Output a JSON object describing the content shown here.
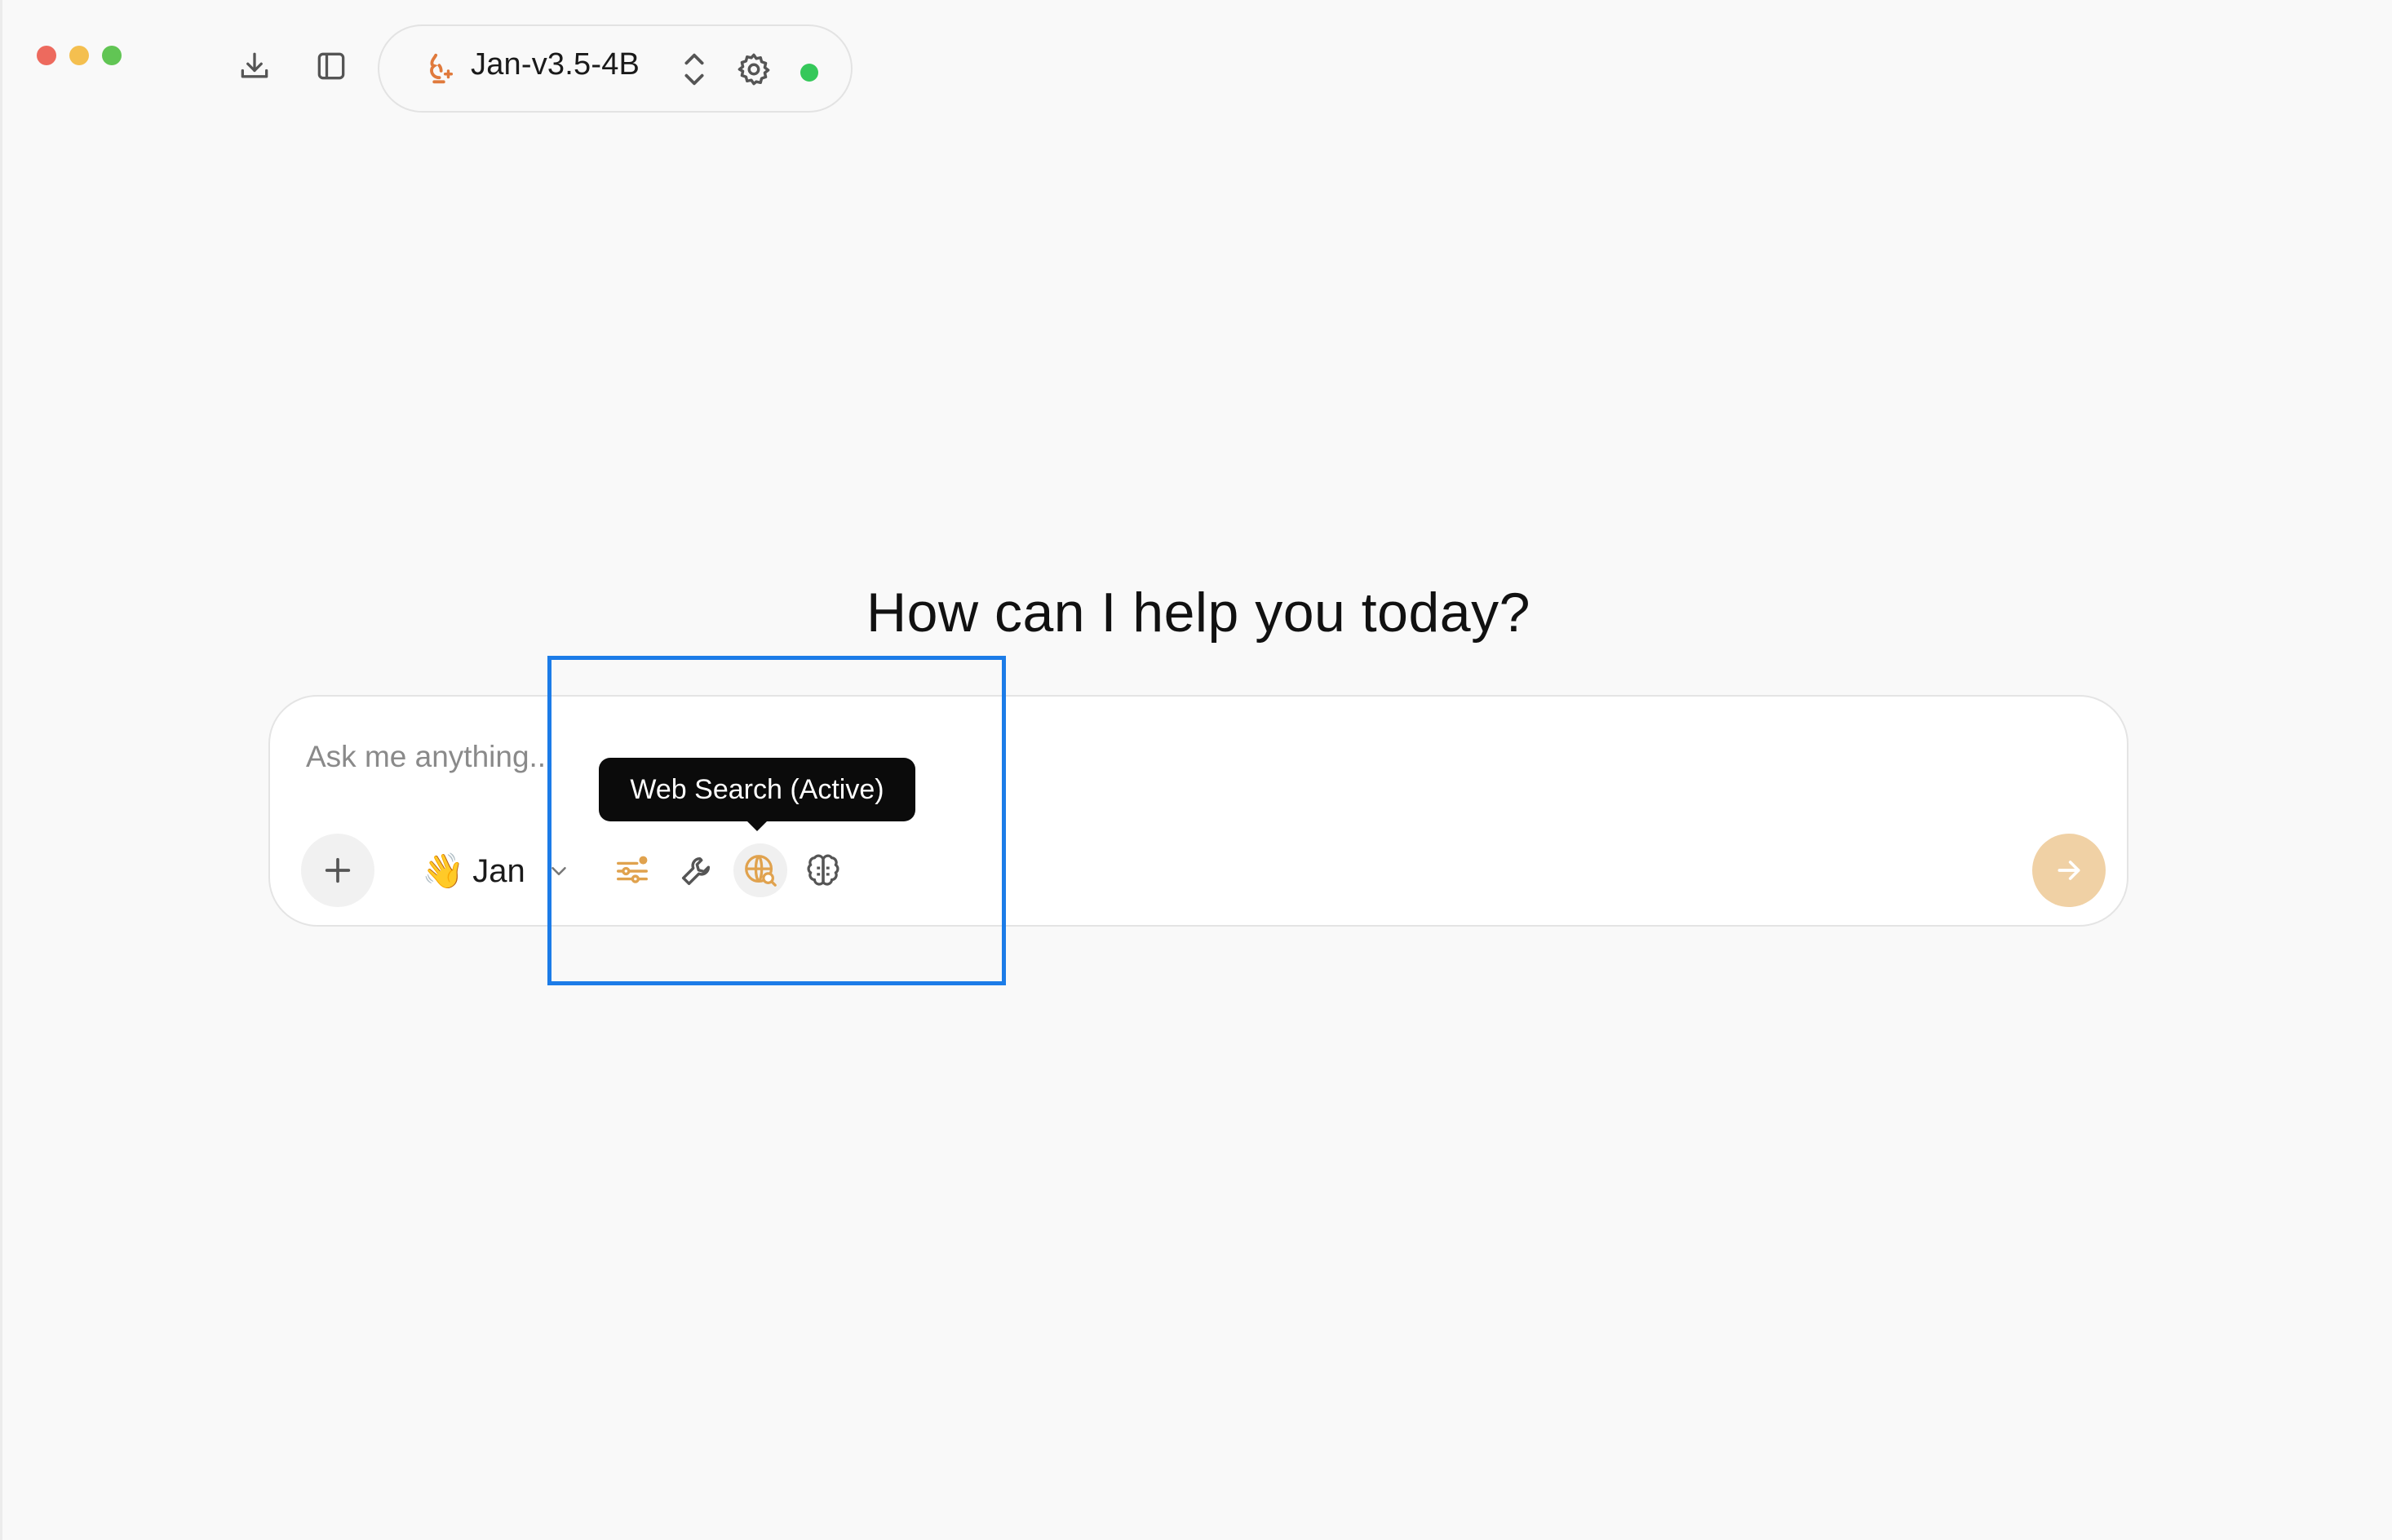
{
  "titlebar": {
    "icons": [
      "download-icon",
      "sidebar-toggle-icon"
    ]
  },
  "model_selector": {
    "name": "Jan-v3.5-4B",
    "logo_icon": "jan-hand-logo-icon",
    "status_color": "#35c85a"
  },
  "main": {
    "heading": "How can I help you today?"
  },
  "composer": {
    "placeholder": "Ask me anything...",
    "assistant_emoji": "👋",
    "assistant_name": "Jan",
    "tools": [
      "sliders-icon",
      "wrench-icon",
      "globe-search-icon",
      "brain-icon"
    ],
    "active_tool": "globe-search-icon"
  },
  "tooltip": {
    "text": "Web Search (Active)"
  },
  "colors": {
    "accent": "#e0a24e",
    "send_button": "#f0d1a5",
    "highlight": "#1c7ce8"
  }
}
